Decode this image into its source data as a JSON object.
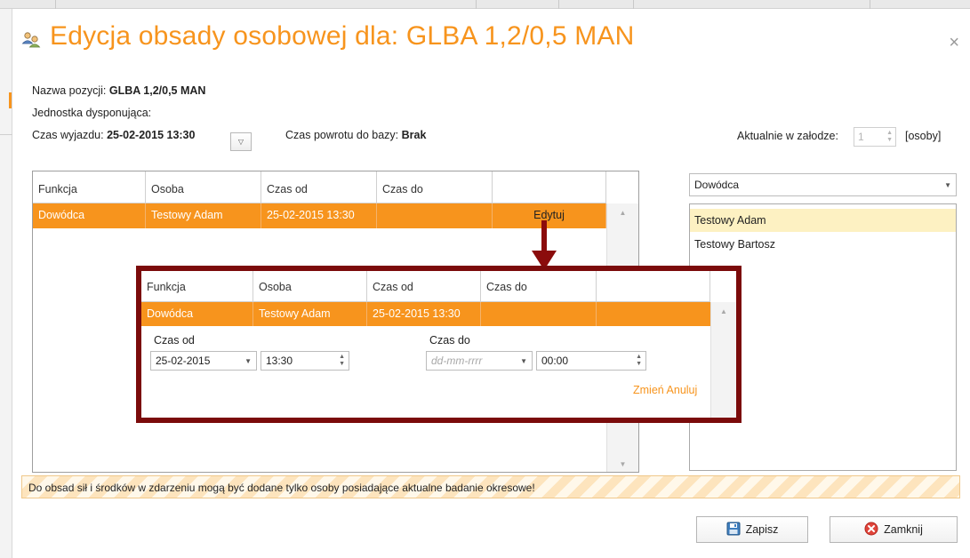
{
  "dialog": {
    "title": "Edycja obsady osobowej dla: GLBA 1,2/0,5 MAN",
    "close_label": "×"
  },
  "info": {
    "position_label": "Nazwa pozycji:",
    "position_value": "GLBA 1,2/0,5 MAN",
    "unit_label": "Jednostka dysponująca:",
    "departure_label": "Czas wyjazdu:",
    "departure_value": "25-02-2015 13:30",
    "return_label": "Czas powrotu do bazy:",
    "return_value": "Brak",
    "crew_label": "Aktualnie w załodze:",
    "crew_value": "1",
    "crew_unit": "[osoby]"
  },
  "grid": {
    "columns": [
      "Funkcja",
      "Osoba",
      "Czas od",
      "Czas do",
      ""
    ],
    "rows": [
      {
        "funkcja": "Dowódca",
        "osoba": "Testowy Adam",
        "czas_od": "25-02-2015 13:30",
        "czas_do": "",
        "action": "Edytuj"
      }
    ]
  },
  "editor": {
    "columns": [
      "Funkcja",
      "Osoba",
      "Czas od",
      "Czas do",
      ""
    ],
    "row": {
      "funkcja": "Dowódca",
      "osoba": "Testowy Adam",
      "czas_od": "25-02-2015 13:30",
      "czas_do": ""
    },
    "from_label": "Czas od",
    "from_date": "25-02-2015",
    "from_time": "13:30",
    "to_label": "Czas do",
    "to_date_placeholder": "dd-mm-rrrr",
    "to_time": "00:00",
    "change_label": "Zmień",
    "cancel_label": "Anuluj"
  },
  "right_panel": {
    "function_selected": "Dowódca",
    "people": [
      "Testowy Adam",
      "Testowy Bartosz"
    ]
  },
  "notice": "Do obsad sił i środków w zdarzeniu mogą być dodane tylko osoby posiadające aktualne badanie okresowe!",
  "buttons": {
    "save": "Zapisz",
    "close": "Zamknij"
  },
  "icons": {
    "title": "people-icon",
    "save": "floppy-disk-icon",
    "close": "close-circle-icon"
  },
  "colors": {
    "accent": "#f7941d",
    "callout_border": "#7b0b0b",
    "selected_item": "#fdf1c2"
  }
}
